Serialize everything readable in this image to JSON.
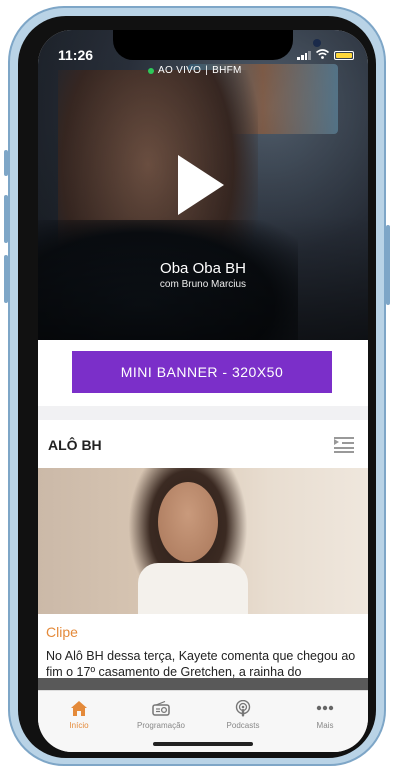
{
  "status_bar": {
    "time": "11:26"
  },
  "live_bar": {
    "label": "AO VIVO",
    "separator": "|",
    "station": "BHFM"
  },
  "hero": {
    "title": "Oba Oba BH",
    "subtitle": "com Bruno Marcius"
  },
  "banner": {
    "label": "MINI BANNER - 320X50"
  },
  "section": {
    "title": "ALÔ BH"
  },
  "card": {
    "tag": "Clipe",
    "text": "No Alô BH dessa terça, Kayete comenta que chegou ao fim o 17º casamento de Gretchen, a rainha do"
  },
  "tabs": [
    {
      "label": "Início",
      "icon": "home-icon"
    },
    {
      "label": "Programação",
      "icon": "radio-icon"
    },
    {
      "label": "Podcasts",
      "icon": "podcast-icon"
    },
    {
      "label": "Mais",
      "icon": "more-icon"
    }
  ],
  "colors": {
    "accent": "#e48a3a",
    "banner": "#7b2fc9",
    "live": "#2ec95a"
  }
}
